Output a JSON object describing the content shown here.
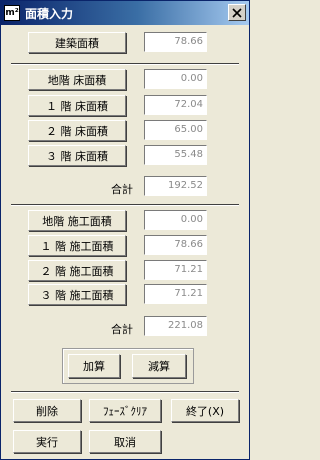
{
  "window": {
    "title": "面積入力",
    "app_icon": "m²",
    "close_icon": "close-icon"
  },
  "building_area": {
    "label": "建築面積",
    "value": "78.66"
  },
  "floor_areas": {
    "rows": [
      {
        "label": "地階  床面積",
        "value": "0.00"
      },
      {
        "label": "１ 階  床面積",
        "value": "72.04"
      },
      {
        "label": "２ 階  床面積",
        "value": "65.00"
      },
      {
        "label": "３ 階  床面積",
        "value": "55.48"
      }
    ],
    "total_label": "合計",
    "total_value": "192.52"
  },
  "construction_areas": {
    "rows": [
      {
        "label": "地階  施工面積",
        "value": "0.00"
      },
      {
        "label": "１ 階  施工面積",
        "value": "78.66"
      },
      {
        "label": "２ 階  施工面積",
        "value": "71.21"
      },
      {
        "label": "３ 階  施工面積",
        "value": "71.21"
      }
    ],
    "total_label": "合計",
    "total_value": "221.08"
  },
  "ops": {
    "add": "加算",
    "subtract": "減算"
  },
  "footer": {
    "delete": "削除",
    "phase_clear": "ﾌｪｰｽﾞｸﾘｱ",
    "exit": "終了(X)",
    "execute": "実行",
    "cancel": "取消"
  }
}
